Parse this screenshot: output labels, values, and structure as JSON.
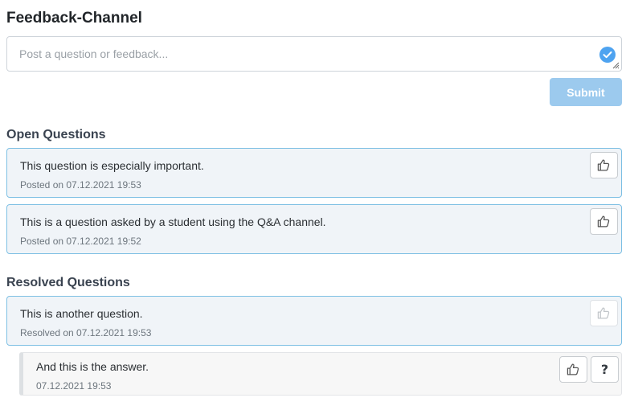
{
  "page": {
    "title": "Feedback-Channel"
  },
  "form": {
    "placeholder": "Post a question or feedback...",
    "value": "",
    "submit_label": "Submit"
  },
  "open_questions": {
    "heading": "Open Questions",
    "items": [
      {
        "text": "This question is especially important.",
        "meta": "Posted on 07.12.2021 19:53",
        "icon": "thumbs-up-icon"
      },
      {
        "text": "This is a question asked by a student using the Q&A channel.",
        "meta": "Posted on 07.12.2021 19:52",
        "icon": "thumbs-up-icon"
      }
    ]
  },
  "resolved_questions": {
    "heading": "Resolved Questions",
    "items": [
      {
        "text": "This is another question.",
        "meta": "Resolved on 07.12.2021 19:53",
        "icon": "thumbs-up-icon",
        "answer": {
          "text": "And this is the answer.",
          "meta": "07.12.2021 19:53",
          "icons": [
            "thumbs-up-icon",
            "question-mark-icon"
          ],
          "question_glyph": "?"
        }
      }
    ]
  },
  "colors": {
    "accent": "#9ccaee",
    "card_border": "#7ec0e4",
    "check": "#4ea3f0"
  }
}
